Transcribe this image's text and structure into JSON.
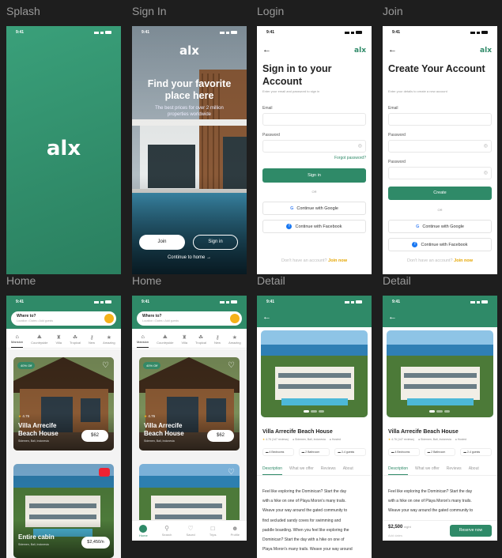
{
  "labels": {
    "splash": "Splash",
    "signin": "Sign In",
    "login": "Login",
    "join": "Join",
    "home1": "Home",
    "home2": "Home",
    "detail1": "Detail",
    "detail2": "Detail"
  },
  "status": {
    "time": "9:41"
  },
  "brand": {
    "logo": "alx",
    "accent": "#2f8a68"
  },
  "signin": {
    "title": "Find your favorite place here",
    "subtitle": "The best prices for over 2 million properties worldwide",
    "join_label": "Join",
    "signin_label": "Sign in",
    "continue_label": "Continue to home"
  },
  "login": {
    "title": "Sign in to your Account",
    "subtitle": "Enter your email and password to sign in",
    "email_label": "Email",
    "password_label": "Password",
    "forgot_label": "Forgot password?",
    "submit_label": "Sign in",
    "or_label": "OR",
    "google_label": "Continue with Google",
    "facebook_label": "Continue with Facebook",
    "footer_text": "Don't have an account?",
    "footer_link": "Join now"
  },
  "join": {
    "title": "Create Your Account",
    "subtitle": "Enter your details to create a new account",
    "email_label": "Email",
    "password_label": "Password",
    "password2_label": "Password",
    "submit_label": "Create",
    "or_label": "OR",
    "google_label": "Continue with Google",
    "facebook_label": "Continue with Facebook",
    "footer_text": "Don't have an account?",
    "footer_link": "Join now"
  },
  "home": {
    "search_title": "Where to?",
    "search_hint": "Location • Dates • Add guests",
    "categories": [
      "Mansion",
      "Countryside",
      "Villa",
      "Tropical",
      "New",
      "Amazing"
    ],
    "card1": {
      "badge": "40% Off",
      "rating": "4.76",
      "name": "Villa Arrecife Beach House",
      "location": "Sidemen, Bali, Indonesia",
      "price": "$62"
    },
    "card2": {
      "name": "Entire cabin",
      "location": "Sidemen, Bali, Indonesia",
      "price": "$2,450/n"
    },
    "nav": [
      "Home",
      "Search",
      "Saved",
      "Trips",
      "Profile"
    ]
  },
  "detail": {
    "name": "Villa Arrecife Beach House",
    "meta_rating": "4.76",
    "meta_reviews": "(147 reviews)",
    "meta_location": "Sidemen, Bali, Indonesia",
    "meta_host": "Hosted",
    "feature1": "4 Bedrooms",
    "feature2": "2 Bathroom",
    "feature3": "2-4 guests",
    "tabs": [
      "Description",
      "What we offer",
      "Reviews",
      "About"
    ],
    "description_lines": [
      "Feel like exploring the Dominican? Start the day",
      "with a hike on one of Playa Moron's many trails.",
      "Weave your way around the gated community to",
      "find secluded sandy coves for swimming and",
      "paddle boarding. When you feel like exploring the",
      "Dominican? Start the day with a hike on one of",
      "Playa Moron's many trails. Weave your way around"
    ],
    "price": "$2,500",
    "price_unit": "night",
    "price_note": "Add dates",
    "reserve_label": "Reserve now"
  }
}
